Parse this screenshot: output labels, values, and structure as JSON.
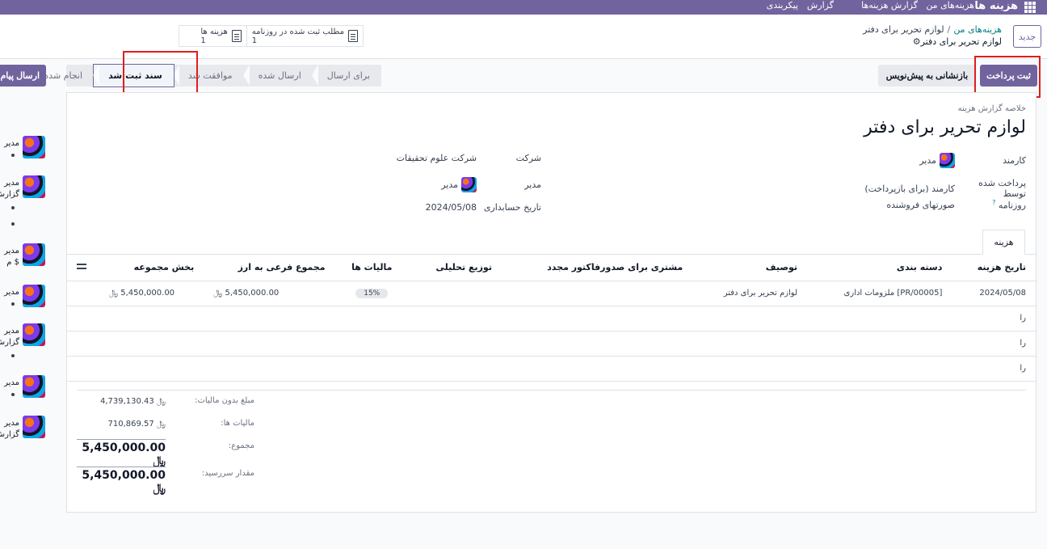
{
  "topbar": {
    "app_name": "هزینه ها",
    "menu": [
      "هزینه‌های من",
      "گزارش هزینه‌ها",
      "گزارش",
      "پیکربندی"
    ]
  },
  "control": {
    "new_label": "جدید",
    "breadcrumb_root": "هزینه‌های من",
    "breadcrumb_sep": "/",
    "breadcrumb_parent": "لوازم تحریر برای دفتر",
    "breadcrumb_current": "لوازم تحریر برای دفتر",
    "smart_buttons": [
      {
        "label": "مطلب ثبت شده در روزنامه",
        "count": "1",
        "icon": "document-icon"
      },
      {
        "label": "هزینه ها",
        "count": "1",
        "icon": "document-icon"
      }
    ]
  },
  "actions": {
    "post_payment": "ثبت پرداخت",
    "reset_draft": "بازنشانی به پیش‌نویس",
    "send_message": "ارسال پیام"
  },
  "statusbar": [
    "برای ارسال",
    "ارسال شده",
    "موافقت شد",
    "سند ثبت شد",
    "انجام شده"
  ],
  "statusbar_active": "سند ثبت شد",
  "form": {
    "subtitle": "خلاصه گزارش هزینه",
    "title": "لوازم تحریر برای دفتر",
    "employee_label": "کارمند",
    "employee_value": "مدیر",
    "paid_by_label": "پرداخت شده توسط",
    "paid_by_value": "کارمند (برای بازپرداخت)",
    "journal_label": "روزنامه",
    "journal_help": "?",
    "journal_value": "صورتهای فروشنده",
    "company_label": "شرکت",
    "company_value": "شرکت علوم تحقیقات",
    "manager_label": "مدیر",
    "manager_value": "مدیر",
    "accounting_date_label": "تاریخ حسابداری",
    "accounting_date_value": "2024/05/08"
  },
  "tab_label": "هزینه",
  "table": {
    "headers": [
      "تاریخ هزینه",
      "دسته بندی",
      "توصیف",
      "مشتری برای صدورفاکتور مجدد",
      "توزیع تحلیلی",
      "مالیات ها",
      "مجموع فرعی به ارز",
      "بخش مجموعه"
    ],
    "row": {
      "date": "2024/05/08",
      "category": "[PR/00005] ملزومات اداری",
      "description": "لوازم تحریر برای دفتر",
      "customer": "",
      "analytic": "",
      "tax": "15%",
      "subtotal": "5,450,000.00 ﷼",
      "total": "5,450,000.00 ﷼"
    },
    "empty_rows": [
      "را",
      "را",
      "را"
    ]
  },
  "totals": [
    {
      "label": "مبلغ بدون مالیات:",
      "value": "4,739,130.43 ﷼"
    },
    {
      "label": "مالیات ها:",
      "value": "710,869.57 ﷼"
    },
    {
      "label": "مجموع:",
      "value": "5,450,000.00 ﷼"
    },
    {
      "label": "مقدار سررسید:",
      "value": "5,450,000.00 ﷼"
    }
  ],
  "chatter": [
    {
      "author": "مدیر",
      "line2": ""
    },
    {
      "author": "مدیر",
      "line2": "گزارش"
    },
    {
      "author": "مدیر",
      "line2": "$ م"
    },
    {
      "author": "مدیر",
      "line2": ""
    },
    {
      "author": "مدیر",
      "line2": "گزارش"
    },
    {
      "author": "مدیر",
      "line2": ""
    },
    {
      "author": "مدیر",
      "line2": "گزارش"
    }
  ],
  "colors": {
    "brand": "#71639e",
    "highlight": "#e11d1d",
    "link": "#017e84"
  }
}
